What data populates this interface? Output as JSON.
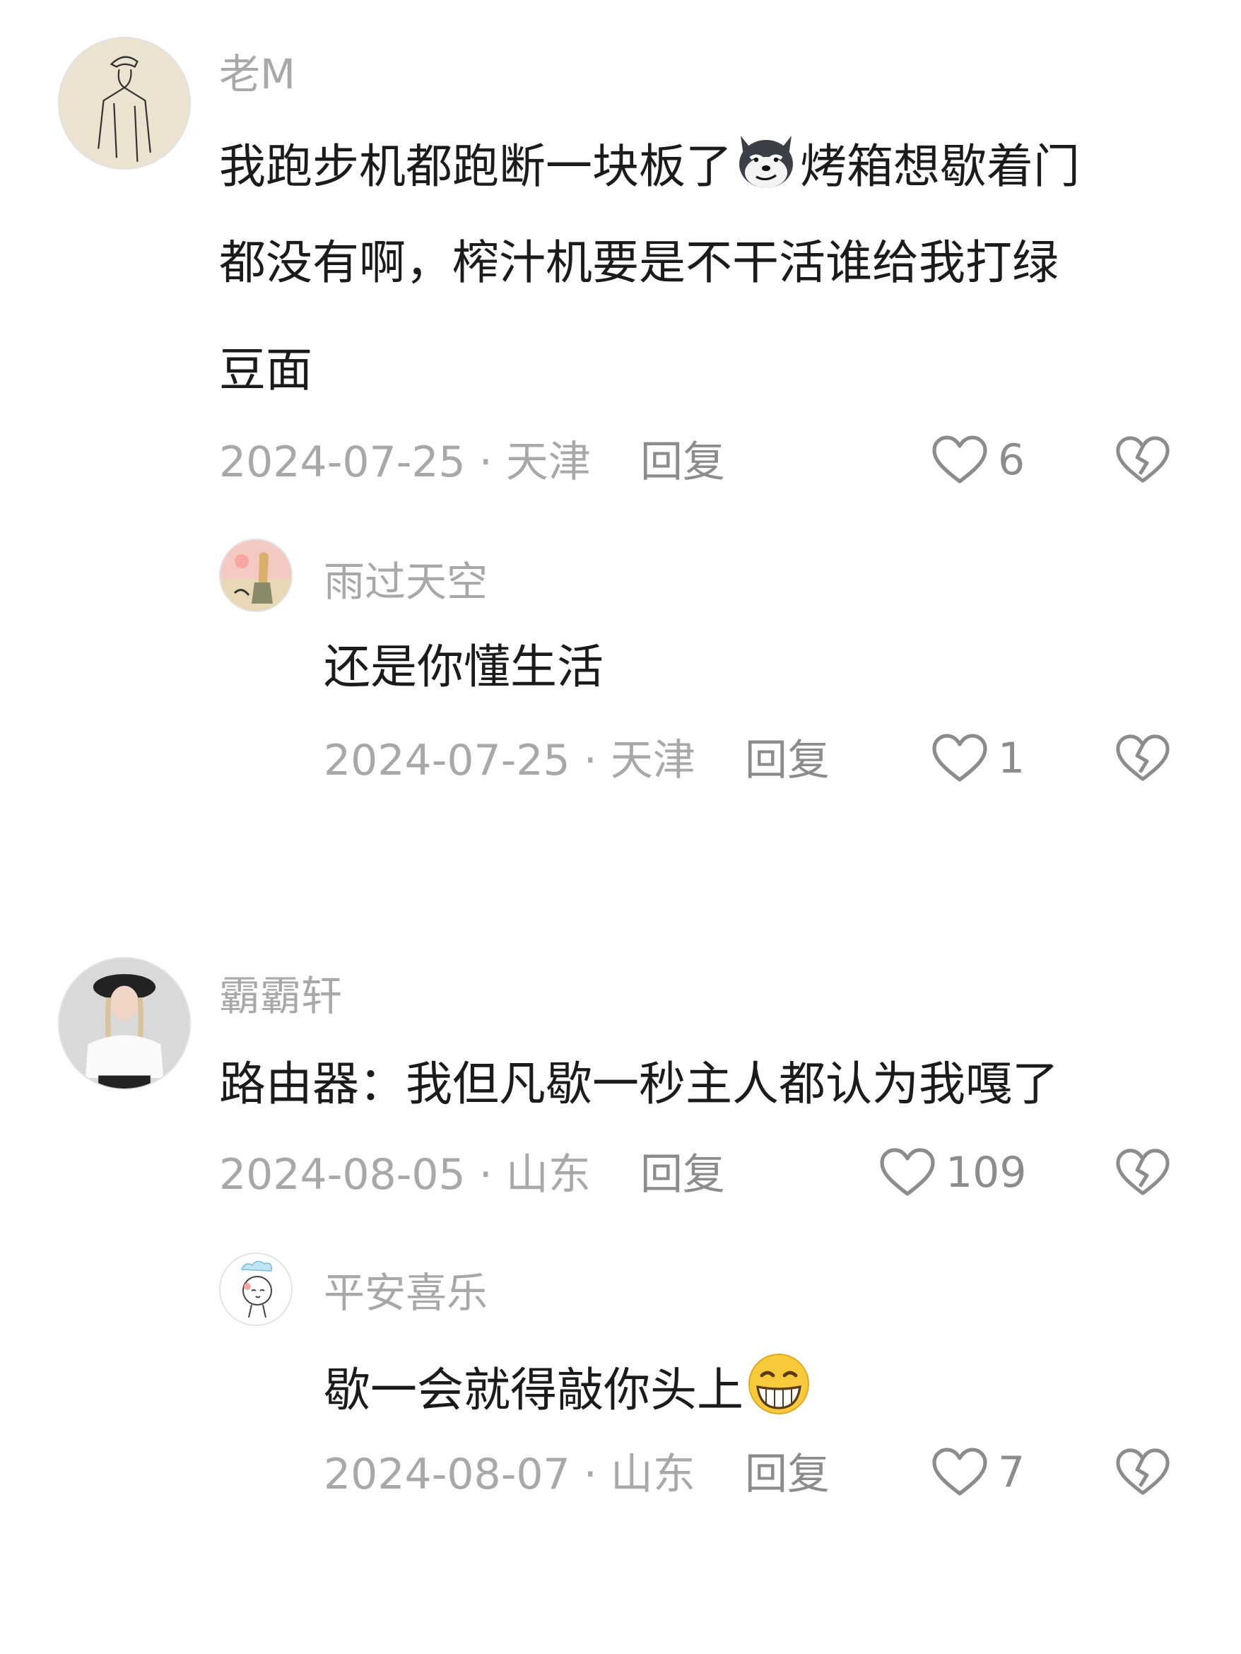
{
  "comments": [
    {
      "username": "老M",
      "lines": [
        {
          "before": "我跑步机都跑断一块板了",
          "emoji": "husky-smirk-emoji",
          "after": "烤箱想歇着门"
        },
        {
          "text": "都没有啊，榨汁机要是不干活谁给我打绿"
        },
        {
          "text": "豆面"
        }
      ],
      "date_location": "2024-07-25 · 天津",
      "reply_label": "回复",
      "likes": "6",
      "replies": [
        {
          "username": "雨过天空",
          "text": "还是你懂生活",
          "date_location": "2024-07-25 · 天津",
          "reply_label": "回复",
          "likes": "1"
        }
      ]
    },
    {
      "username": "霸霸轩",
      "text": "路由器：我但凡歇一秒主人都认为我嘎了",
      "date_location": "2024-08-05 · 山东",
      "reply_label": "回复",
      "likes": "109",
      "replies": [
        {
          "username": "平安喜乐",
          "text_before_emoji": "歇一会就得敲你头上",
          "emoji": "grin-emoji",
          "date_location": "2024-08-07 · 山东",
          "reply_label": "回复",
          "likes": "7"
        }
      ]
    }
  ],
  "icons": {
    "like": "heart-outline-icon",
    "dislike": "broken-heart-icon"
  },
  "colors": {
    "primary_text": "#1b1b1b",
    "secondary_text": "#a8a8a8",
    "icon": "#8c8c8c"
  }
}
